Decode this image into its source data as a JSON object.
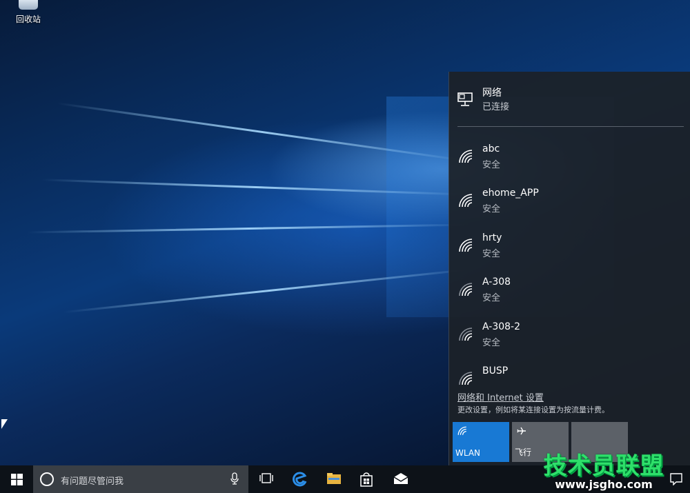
{
  "desktop": {
    "recycle_bin_label": "回收站"
  },
  "network_flyout": {
    "title": "网络",
    "status": "已连接",
    "wifi_networks": [
      {
        "name": "abc",
        "security": "安全"
      },
      {
        "name": "ehome_APP",
        "security": "安全"
      },
      {
        "name": "hrty",
        "security": "安全"
      },
      {
        "name": "A-308",
        "security": "安全"
      },
      {
        "name": "A-308-2",
        "security": "安全"
      },
      {
        "name": "BUSP",
        "security": ""
      }
    ],
    "settings_link": "网络和 Internet 设置",
    "settings_desc": "更改设置，例如将某连接设置为按流量计费。",
    "tiles": {
      "wlan": "WLAN",
      "airplane": "飞行"
    },
    "colors": {
      "wlan_tile": "#1879d4",
      "flyout_bg": "#1c2128"
    }
  },
  "taskbar": {
    "search_placeholder": "有问题尽管问我",
    "icons": [
      "windows-start-icon",
      "cortana-icon",
      "microphone-icon",
      "task-view-icon",
      "edge-icon",
      "file-explorer-icon",
      "store-icon",
      "mail-icon",
      "action-center-icon"
    ]
  },
  "watermark": {
    "brand": "技术员联盟",
    "url": "www.jsgho.com"
  }
}
